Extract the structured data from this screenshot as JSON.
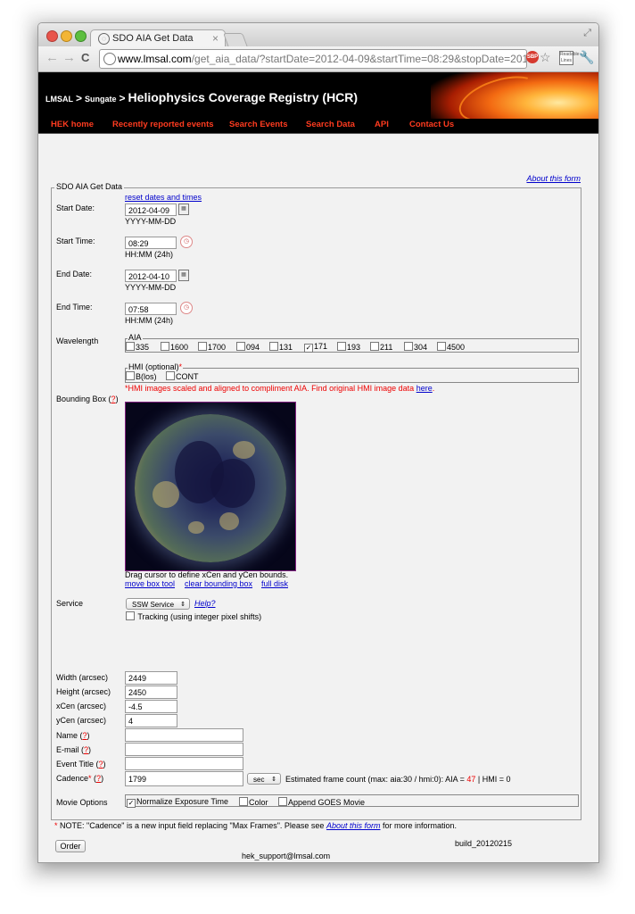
{
  "browser": {
    "tab_title": "SDO AIA Get Data",
    "tab_close": "×",
    "url_host": "www.lmsal.com",
    "url_path": "/get_aia_data/?startDate=2012-04-09&startTime=08:29&stopDate=2012-04-...",
    "back": "←",
    "forward": "→",
    "reload": "C",
    "ext_sbp": "SBP",
    "ext_label": "Readable Lines",
    "star": "☆",
    "wrench": "🔧",
    "resize": "⤢"
  },
  "banner": {
    "crumb1": "LMSAL",
    "sep1": ">",
    "crumb2": "Sungate",
    "sep2": ">",
    "title": "Heliophysics Coverage Registry (HCR)"
  },
  "nav": [
    "HEK home",
    "Recently reported events",
    "Search Events",
    "Search Data",
    "API",
    "Contact Us"
  ],
  "about_link": "About this form",
  "form": {
    "legend": "SDO AIA Get Data",
    "reset_link": "reset dates and times",
    "start_date": {
      "label": "Start Date:",
      "value": "2012-04-09",
      "hint": "YYYY-MM-DD"
    },
    "start_time": {
      "label": "Start Time:",
      "value": "08:29",
      "hint": "HH:MM (24h)"
    },
    "end_date": {
      "label": "End Date:",
      "value": "2012-04-10",
      "hint": "YYYY-MM-DD"
    },
    "end_time": {
      "label": "End Time:",
      "value": "07:58",
      "hint": "HH:MM (24h)"
    },
    "wavelength_label": "Wavelength",
    "aia_legend": "AIA",
    "aia_options": [
      {
        "label": "335",
        "checked": false
      },
      {
        "label": "1600",
        "checked": false
      },
      {
        "label": "1700",
        "checked": false
      },
      {
        "label": "094",
        "checked": false
      },
      {
        "label": "131",
        "checked": false
      },
      {
        "label": "171",
        "checked": true
      },
      {
        "label": "193",
        "checked": false
      },
      {
        "label": "211",
        "checked": false
      },
      {
        "label": "304",
        "checked": false
      },
      {
        "label": "4500",
        "checked": false
      }
    ],
    "hmi_legend": "HMI (optional)",
    "hmi_asterisk": "*",
    "hmi_options": [
      {
        "label": "B(los)",
        "checked": false
      },
      {
        "label": "CONT",
        "checked": false
      }
    ],
    "hmi_note": "*HMI images scaled and aligned to compliment AIA. Find original HMI image data",
    "hmi_note_link": "here",
    "hmi_note_end": ".",
    "bbox_label": "Bounding Box",
    "help_q": "?",
    "drag_text": "Drag cursor to define xCen and yCen bounds.",
    "move_box": "move box tool",
    "clear_box": "clear bounding box",
    "full_disk": "full disk",
    "service_label": "Service",
    "service_value": "SSW Service",
    "service_help": "Help?",
    "tracking_label": "Tracking (using integer pixel shifts)",
    "width": {
      "label": "Width (arcsec)",
      "value": "2449"
    },
    "height": {
      "label": "Height (arcsec)",
      "value": "2450"
    },
    "xcen": {
      "label": "xCen (arcsec)",
      "value": "-4.5"
    },
    "ycen": {
      "label": "yCen (arcsec)",
      "value": "4"
    },
    "name_label": "Name",
    "email_label": "E-mail",
    "event_title_label": "Event Title",
    "cadence_label": "Cadence",
    "cadence_value": "1799",
    "cadence_unit": "sec",
    "frame_count_prefix": "Estimated frame count (max: aia:30 / hmi:0): AIA =",
    "frame_aia": "47",
    "frame_hmi": "| HMI = 0",
    "movie_label": "Movie Options",
    "movie_options": [
      {
        "label": "Normalize Exposure Time",
        "checked": true
      },
      {
        "label": "Color",
        "checked": false
      },
      {
        "label": "Append GOES Movie",
        "checked": false
      }
    ],
    "note_prefix": "NOTE: \"Cadence\" is a new input field replacing \"Max Frames\". Please see",
    "note_link": "About this form",
    "note_suffix": "for more information.",
    "order_button": "Order",
    "build": "build_20120215",
    "contact": "hek_support@lmsal.com"
  }
}
